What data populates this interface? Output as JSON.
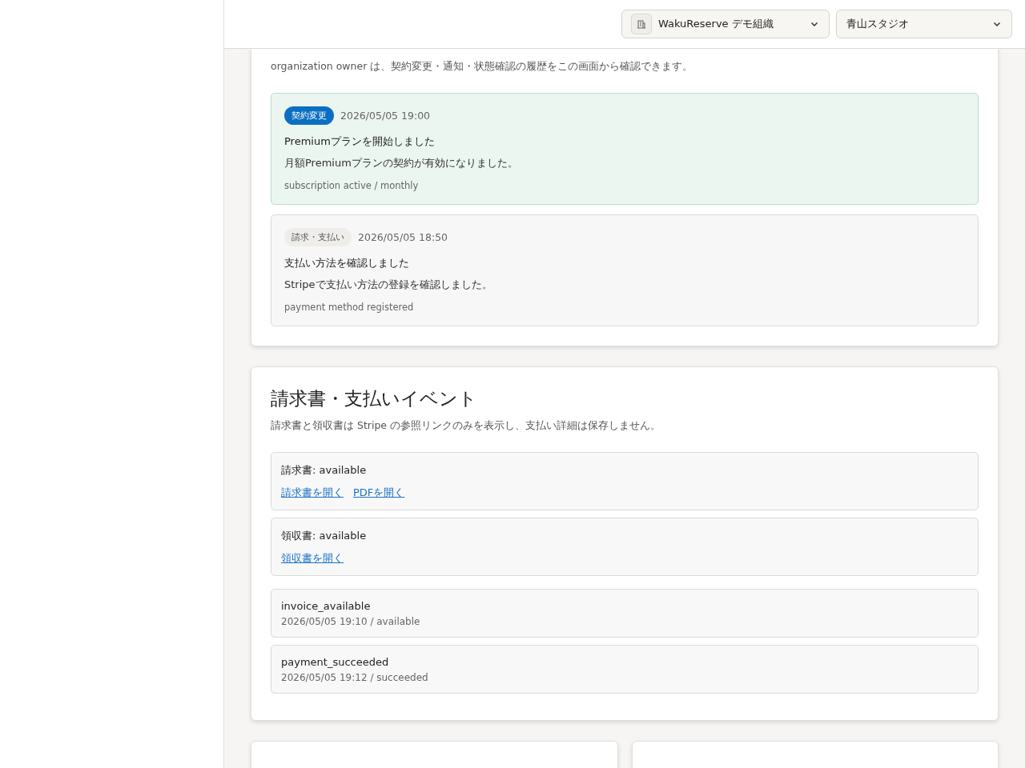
{
  "header": {
    "organization_select": {
      "value": "WakuReserve デモ組織"
    },
    "store_select": {
      "value": "青山スタジオ"
    }
  },
  "contract_history": {
    "description": "organization owner は、契約変更・通知・状態確認の履歴をこの画面から確認できます。",
    "entries": [
      {
        "kind": "highlight",
        "category": "契約変更",
        "time": "2026/05/05 19:00",
        "title": "Premiumプランを開始しました",
        "body": "月額Premiumプランの契約が有効になりました。",
        "meta": "subscription active / monthly"
      },
      {
        "kind": "normal",
        "category": "請求・支払い",
        "time": "2026/05/05 18:50",
        "title": "支払い方法を確認しました",
        "body": "Stripeで支払い方法の登録を確認しました。",
        "meta": "payment method registered"
      }
    ]
  },
  "billing_events": {
    "title": "請求書・支払いイベント",
    "description": "請求書と領収書は Stripe の参照リンクのみを表示し、支払い詳細は保存しません。",
    "documents": [
      {
        "label": "請求書: available",
        "links": [
          "請求書を開く",
          "PDFを開く"
        ]
      },
      {
        "label": "領収書: available",
        "links": [
          "領収書を開く"
        ]
      }
    ],
    "events": [
      {
        "name": "invoice_available",
        "detail": "2026/05/05 19:10 / available"
      },
      {
        "name": "payment_succeeded",
        "detail": "2026/05/05 19:12 / succeeded"
      }
    ]
  },
  "bottom_cards": [
    {
      "kind": "card"
    },
    {
      "kind": "card"
    }
  ]
}
